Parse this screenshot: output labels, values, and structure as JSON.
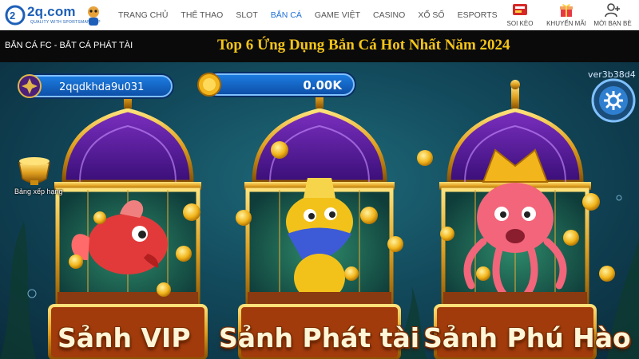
{
  "brand": {
    "logo_text": "2q.com",
    "tagline": "QUALITY WITH SPORTSMANSHIP"
  },
  "nav": {
    "items": [
      {
        "label": "TRANG CHỦ",
        "active": false
      },
      {
        "label": "THỂ THAO",
        "active": false
      },
      {
        "label": "SLOT",
        "active": false
      },
      {
        "label": "BẮN CÁ",
        "active": true
      },
      {
        "label": "GAME VIỆT",
        "active": false
      },
      {
        "label": "CASINO",
        "active": false
      },
      {
        "label": "XỔ SỐ",
        "active": false
      },
      {
        "label": "ESPORTS",
        "active": false
      }
    ],
    "actions": [
      {
        "label": "SOI KÈO",
        "icon": "soi-keo-icon"
      },
      {
        "label": "KHUYẾN MÃI",
        "icon": "gift-icon"
      },
      {
        "label": "MỜI BẠN BÈ",
        "icon": "invite-friends-icon"
      }
    ],
    "accent_color": "#1d6fd8"
  },
  "subbar": {
    "breadcrumb": "BẮN CÁ FC - BẮT CÁ PHÁT TÀI",
    "headline": "Top 6 Ứng Dụng Bắn Cá Hot Nhất Năm 2024"
  },
  "game": {
    "user_id": "2qqdkhda9u031",
    "balance": "0.00K",
    "version": "ver3b38d4",
    "ranking_label": "Bảng xếp hạng",
    "halls": [
      {
        "label": "Sảnh VIP",
        "creature": "red-fish"
      },
      {
        "label": "Sảnh Phát tài",
        "creature": "yellow-platypus"
      },
      {
        "label": "Sảnh Phú Hào",
        "creature": "pink-octopus"
      }
    ]
  }
}
